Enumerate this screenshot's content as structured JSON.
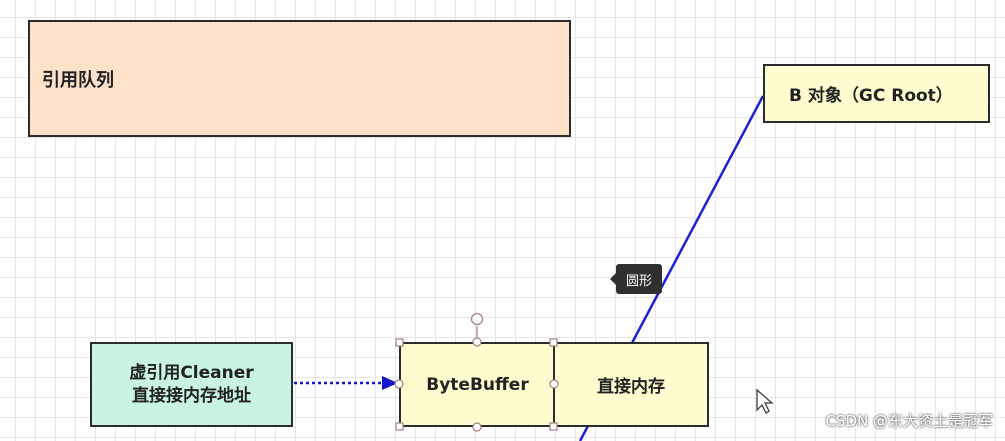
{
  "nodes": {
    "queue": {
      "label": "引用队列"
    },
    "b_object": {
      "label": "B 对象（GC Root）"
    },
    "cleaner": {
      "line1": "虚引用Cleaner",
      "line2": "直接接内存地址"
    },
    "bytebuffer": {
      "label": "ByteBuffer"
    },
    "direct_memory": {
      "label": "直接内存"
    }
  },
  "tooltip": {
    "label": "圆形"
  },
  "watermark": {
    "text": "CSDN @东大资土是冠军"
  },
  "colors": {
    "connector": "#1a22d6",
    "arrow": "#1515cc",
    "handle": "#a87e7e"
  }
}
